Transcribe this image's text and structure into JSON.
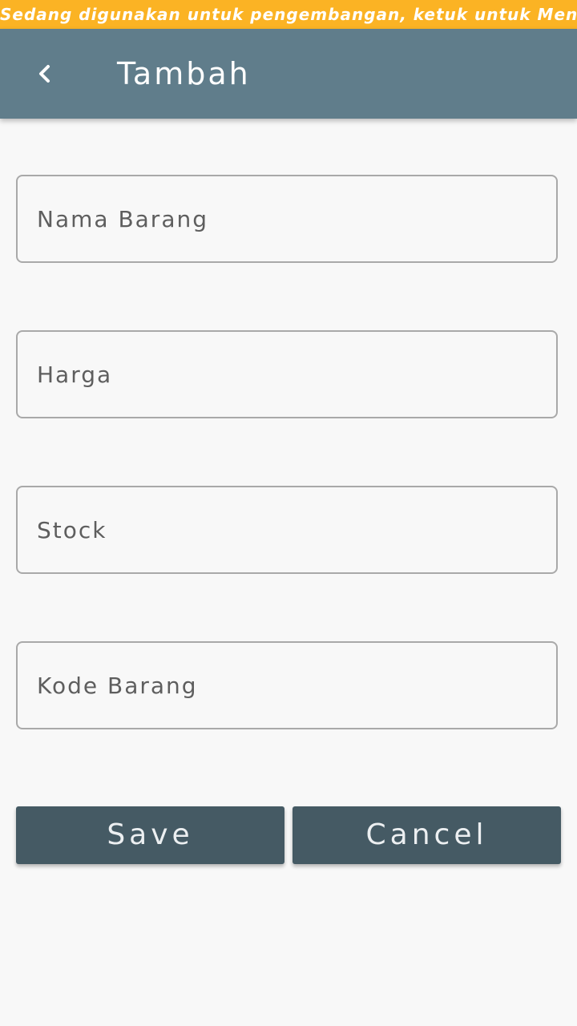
{
  "dev_banner": {
    "text": "Sedang digunakan untuk pengembangan, ketuk untuk Menutup",
    "color": "#fbb324"
  },
  "app_bar": {
    "title": "Tambah",
    "back_icon": "chevron-left-icon",
    "color": "#607d8b"
  },
  "form": {
    "fields": [
      {
        "placeholder": "Nama Barang",
        "value": ""
      },
      {
        "placeholder": "Harga",
        "value": ""
      },
      {
        "placeholder": "Stock",
        "value": ""
      },
      {
        "placeholder": "Kode Barang",
        "value": ""
      }
    ],
    "save_label": "Save",
    "cancel_label": "Cancel",
    "button_color": "#455a64"
  }
}
